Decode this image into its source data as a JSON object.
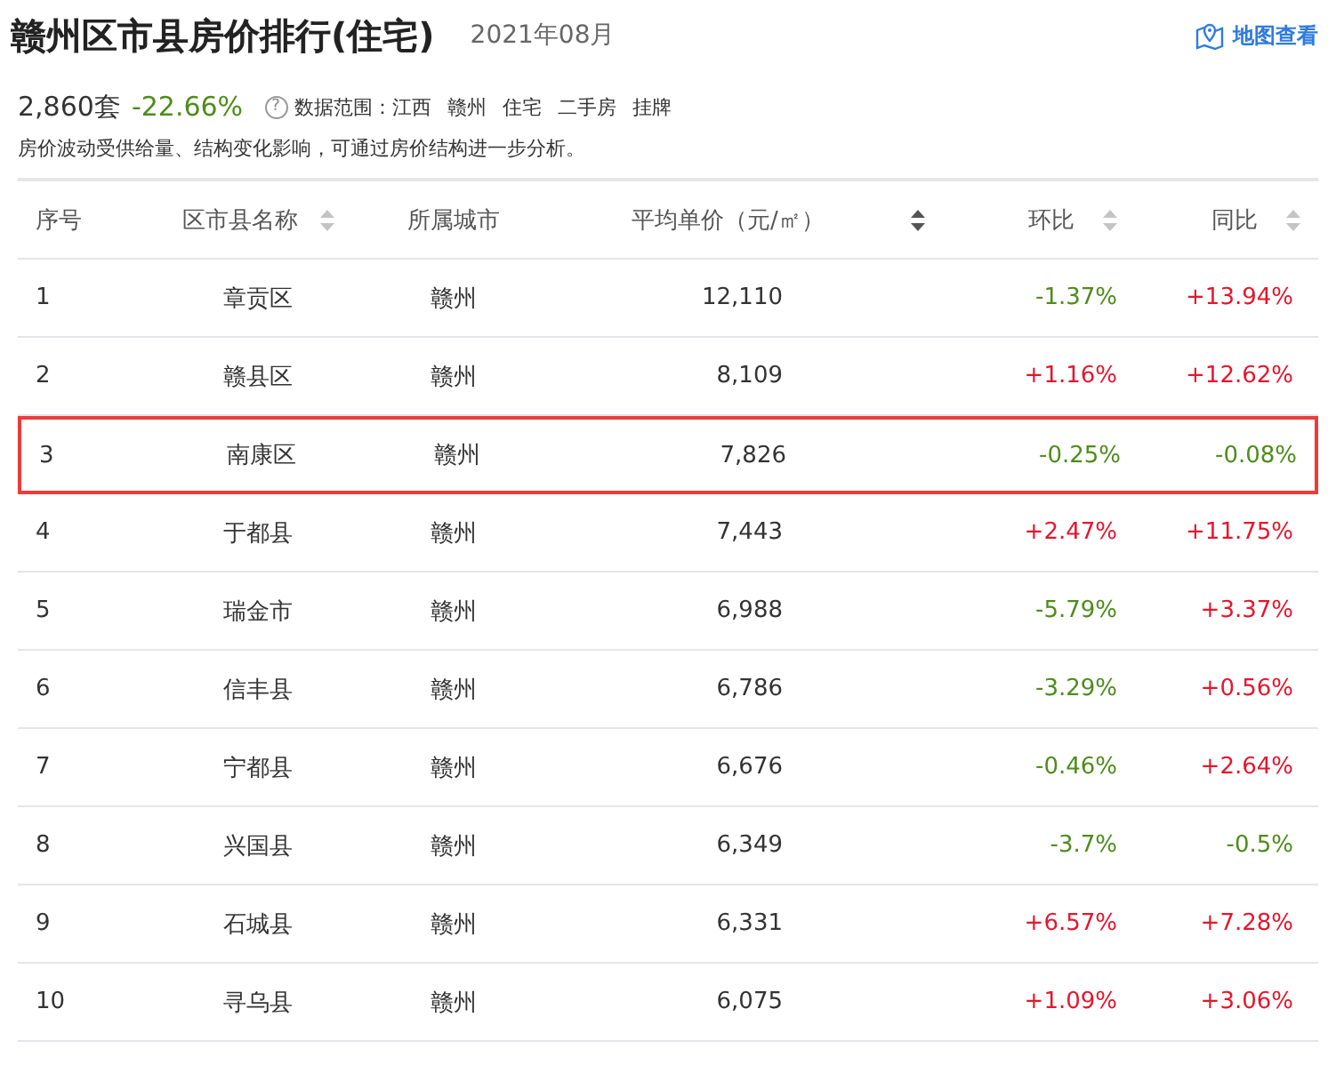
{
  "header": {
    "title": "赣州区市县房价排行(住宅)",
    "period": "2021年08月",
    "map_link": "地图查看"
  },
  "summary": {
    "count": "2,860套",
    "change": {
      "text": "-22.66%",
      "color": "#4e8c1c"
    },
    "help": "?",
    "scope_label": "数据范围：",
    "scope": [
      "江西",
      "赣州",
      "住宅",
      "二手房",
      "挂牌"
    ],
    "note": "房价波动受供给量、结构变化影响，可通过房价结构进一步分析。"
  },
  "table": {
    "columns": [
      {
        "label": "序号",
        "sortable": false
      },
      {
        "label": "区市县名称",
        "sortable": true,
        "sorted": false
      },
      {
        "label": "所属城市",
        "sortable": false
      },
      {
        "label": "平均单价（元/㎡）",
        "sortable": true,
        "sorted": true
      },
      {
        "label": "环比",
        "sortable": true,
        "sorted": false
      },
      {
        "label": "同比",
        "sortable": true,
        "sorted": false
      }
    ],
    "rows": [
      {
        "rank": "1",
        "name": "章贡区",
        "city": "赣州",
        "price": "12,110",
        "mom": {
          "text": "-1.37%",
          "color": "#4e8c1c"
        },
        "yoy": {
          "text": "+13.94%",
          "color": "#e5162d"
        },
        "highlighted": false
      },
      {
        "rank": "2",
        "name": "赣县区",
        "city": "赣州",
        "price": "8,109",
        "mom": {
          "text": "+1.16%",
          "color": "#e5162d"
        },
        "yoy": {
          "text": "+12.62%",
          "color": "#e5162d"
        },
        "highlighted": false
      },
      {
        "rank": "3",
        "name": "南康区",
        "city": "赣州",
        "price": "7,826",
        "mom": {
          "text": "-0.25%",
          "color": "#4e8c1c"
        },
        "yoy": {
          "text": "-0.08%",
          "color": "#4e8c1c"
        },
        "highlighted": true
      },
      {
        "rank": "4",
        "name": "于都县",
        "city": "赣州",
        "price": "7,443",
        "mom": {
          "text": "+2.47%",
          "color": "#e5162d"
        },
        "yoy": {
          "text": "+11.75%",
          "color": "#e5162d"
        },
        "highlighted": false
      },
      {
        "rank": "5",
        "name": "瑞金市",
        "city": "赣州",
        "price": "6,988",
        "mom": {
          "text": "-5.79%",
          "color": "#4e8c1c"
        },
        "yoy": {
          "text": "+3.37%",
          "color": "#e5162d"
        },
        "highlighted": false
      },
      {
        "rank": "6",
        "name": "信丰县",
        "city": "赣州",
        "price": "6,786",
        "mom": {
          "text": "-3.29%",
          "color": "#4e8c1c"
        },
        "yoy": {
          "text": "+0.56%",
          "color": "#e5162d"
        },
        "highlighted": false
      },
      {
        "rank": "7",
        "name": "宁都县",
        "city": "赣州",
        "price": "6,676",
        "mom": {
          "text": "-0.46%",
          "color": "#4e8c1c"
        },
        "yoy": {
          "text": "+2.64%",
          "color": "#e5162d"
        },
        "highlighted": false
      },
      {
        "rank": "8",
        "name": "兴国县",
        "city": "赣州",
        "price": "6,349",
        "mom": {
          "text": "-3.7%",
          "color": "#4e8c1c"
        },
        "yoy": {
          "text": "-0.5%",
          "color": "#4e8c1c"
        },
        "highlighted": false
      },
      {
        "rank": "9",
        "name": "石城县",
        "city": "赣州",
        "price": "6,331",
        "mom": {
          "text": "+6.57%",
          "color": "#e5162d"
        },
        "yoy": {
          "text": "+7.28%",
          "color": "#e5162d"
        },
        "highlighted": false
      },
      {
        "rank": "10",
        "name": "寻乌县",
        "city": "赣州",
        "price": "6,075",
        "mom": {
          "text": "+1.09%",
          "color": "#e5162d"
        },
        "yoy": {
          "text": "+3.06%",
          "color": "#e5162d"
        },
        "highlighted": false
      }
    ]
  }
}
